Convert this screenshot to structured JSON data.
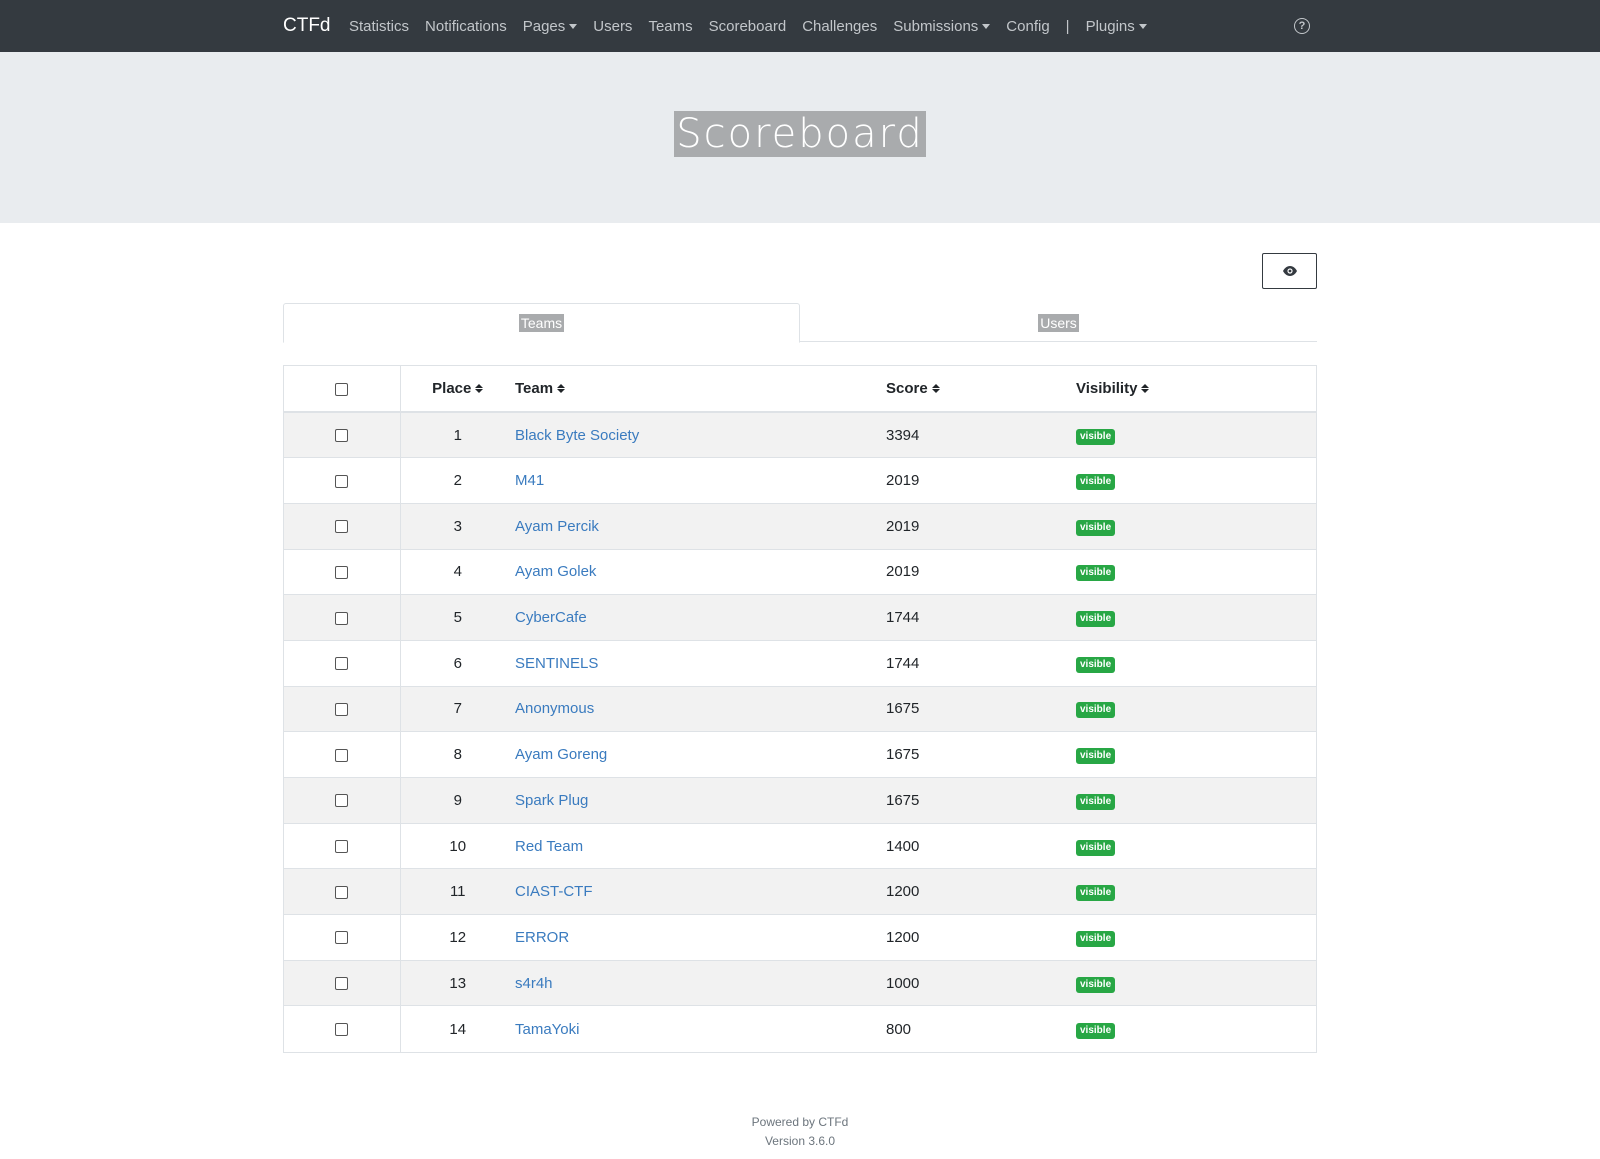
{
  "navbar": {
    "brand": "CTFd",
    "links": [
      {
        "label": "Statistics",
        "dropdown": false
      },
      {
        "label": "Notifications",
        "dropdown": false
      },
      {
        "label": "Pages",
        "dropdown": true
      },
      {
        "label": "Users",
        "dropdown": false
      },
      {
        "label": "Teams",
        "dropdown": false
      },
      {
        "label": "Scoreboard",
        "dropdown": false
      },
      {
        "label": "Challenges",
        "dropdown": false
      },
      {
        "label": "Submissions",
        "dropdown": true
      },
      {
        "label": "Config",
        "dropdown": false
      }
    ],
    "separator": "|",
    "plugins": "Plugins",
    "help_icon": "question-circle-icon"
  },
  "page_title": "Scoreboard",
  "toggle_icon": "eye-icon",
  "tabs": [
    {
      "label": "Teams",
      "active": true
    },
    {
      "label": "Users",
      "active": false
    }
  ],
  "table": {
    "headers": {
      "place": "Place",
      "team": "Team",
      "score": "Score",
      "visibility": "Visibility"
    },
    "rows": [
      {
        "place": "1",
        "team": "Black Byte Society",
        "score": "3394",
        "visibility": "visible"
      },
      {
        "place": "2",
        "team": "M41",
        "score": "2019",
        "visibility": "visible"
      },
      {
        "place": "3",
        "team": "Ayam Percik",
        "score": "2019",
        "visibility": "visible"
      },
      {
        "place": "4",
        "team": "Ayam Golek",
        "score": "2019",
        "visibility": "visible"
      },
      {
        "place": "5",
        "team": "CyberCafe",
        "score": "1744",
        "visibility": "visible"
      },
      {
        "place": "6",
        "team": "SENTINELS",
        "score": "1744",
        "visibility": "visible"
      },
      {
        "place": "7",
        "team": "Anonymous",
        "score": "1675",
        "visibility": "visible"
      },
      {
        "place": "8",
        "team": "Ayam Goreng",
        "score": "1675",
        "visibility": "visible"
      },
      {
        "place": "9",
        "team": "Spark Plug",
        "score": "1675",
        "visibility": "visible"
      },
      {
        "place": "10",
        "team": "Red Team",
        "score": "1400",
        "visibility": "visible"
      },
      {
        "place": "11",
        "team": "CIAST-CTF",
        "score": "1200",
        "visibility": "visible"
      },
      {
        "place": "12",
        "team": "ERROR",
        "score": "1200",
        "visibility": "visible"
      },
      {
        "place": "13",
        "team": "s4r4h",
        "score": "1000",
        "visibility": "visible"
      },
      {
        "place": "14",
        "team": "TamaYoki",
        "score": "800",
        "visibility": "visible"
      }
    ]
  },
  "footer": {
    "powered": "Powered by CTFd",
    "version": "Version 3.6.0"
  },
  "colors": {
    "navbar": "#343a40",
    "jumbotron": "#e9ecef",
    "link": "#3a7bbf",
    "badge": "#28a745"
  }
}
